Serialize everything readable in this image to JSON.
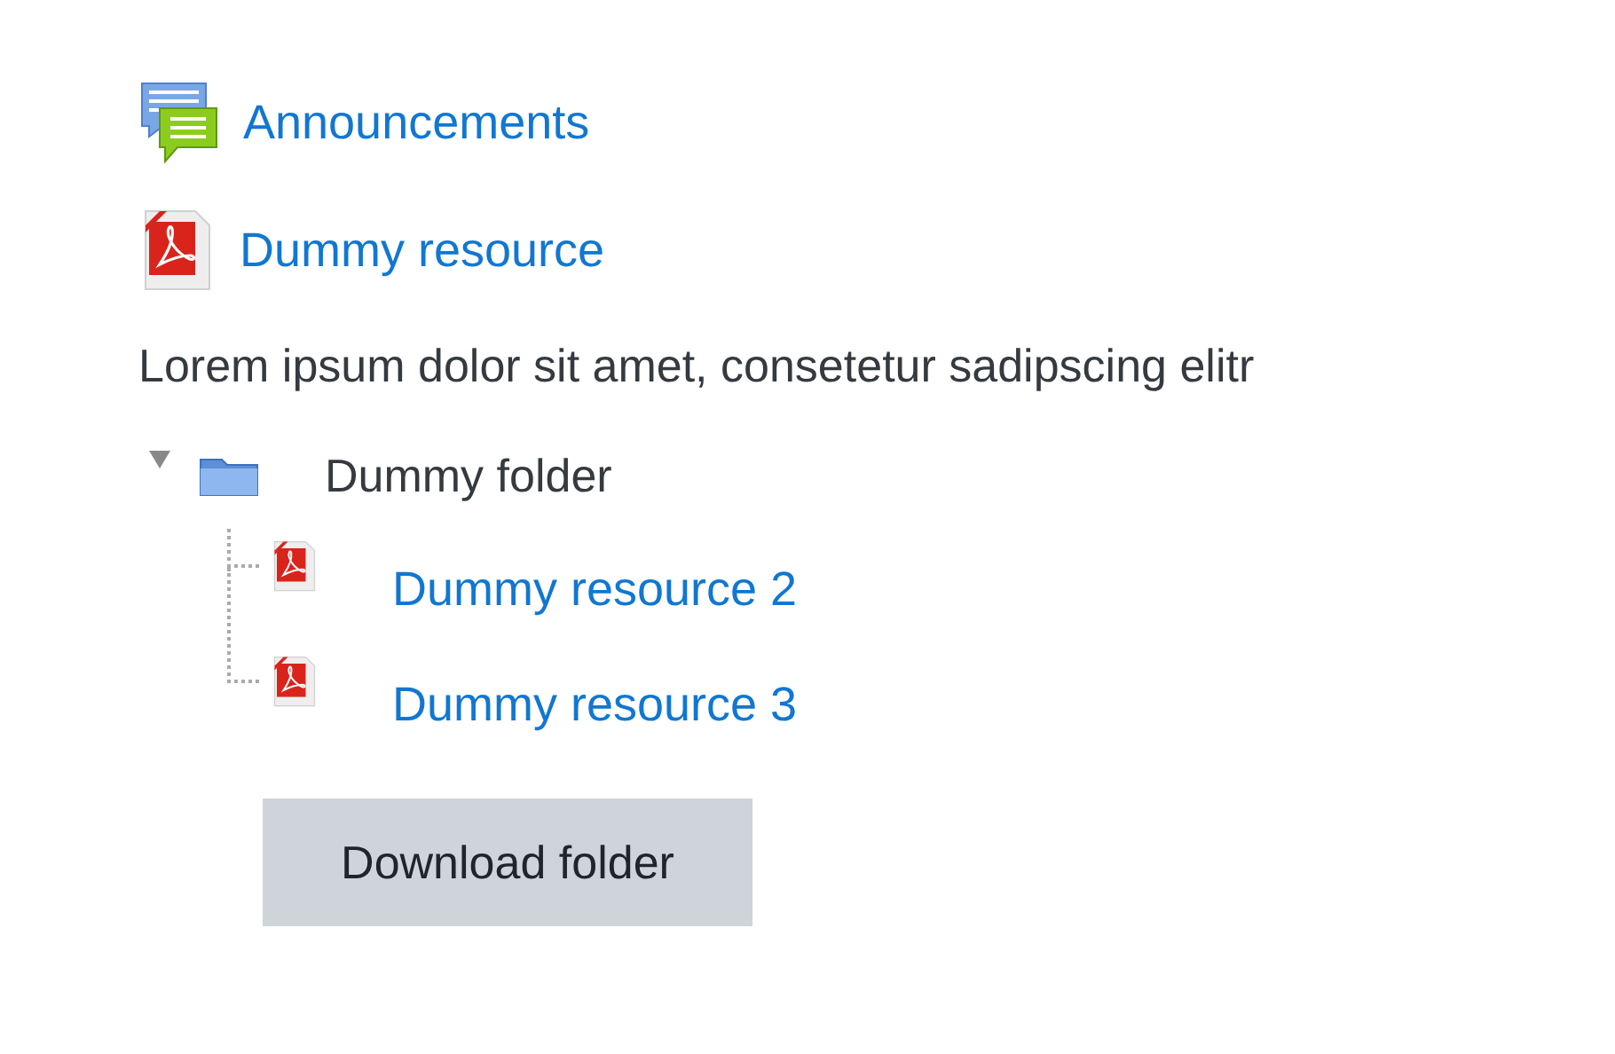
{
  "activities": [
    {
      "kind": "forum",
      "label": "Announcements"
    },
    {
      "kind": "pdf",
      "label": "Dummy resource"
    },
    {
      "kind": "text",
      "label": "Lorem ipsum dolor sit amet, consetetur sadipscing elitr"
    },
    {
      "kind": "folder",
      "label": "Dummy folder",
      "expanded": true,
      "children": [
        {
          "kind": "pdf",
          "label": "Dummy resource 2"
        },
        {
          "kind": "pdf",
          "label": "Dummy resource 3"
        }
      ],
      "button": "Download folder"
    }
  ]
}
